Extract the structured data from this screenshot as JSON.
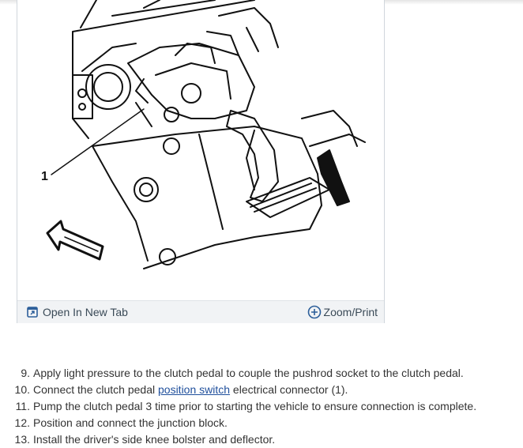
{
  "figure": {
    "callout": "1",
    "toolbar": {
      "open_icon": "open-in-new-tab-icon",
      "open_label": "Open In New Tab",
      "zoom_icon": "plus-circle-icon",
      "zoom_label": "Zoom/Print"
    }
  },
  "steps": [
    {
      "num": "9.",
      "text": "Apply light pressure to the clutch pedal to couple the pushrod socket to the clutch pedal."
    },
    {
      "num": "10.",
      "before": "Connect the clutch pedal ",
      "link": "position switch",
      "after": " electrical connector (1)."
    },
    {
      "num": "11.",
      "text": "Pump the clutch pedal 3 time prior to starting the vehicle to ensure connection is complete."
    },
    {
      "num": "12.",
      "text": "Position and connect the junction block."
    },
    {
      "num": "13.",
      "text": "Install the driver's side knee bolster and deflector."
    }
  ],
  "colors": {
    "link": "#1f4f9c",
    "toolbar_bg": "#f1f3f5",
    "text": "#333333"
  }
}
